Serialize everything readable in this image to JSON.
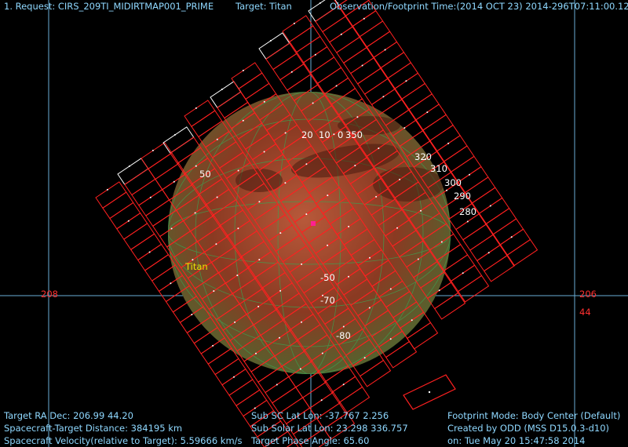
{
  "header": {
    "request": "1. Request: CIRS_209TI_MIDIRTMAP001_PRIME",
    "target": "Target: Titan",
    "observation_time": "Observation/Footprint Time:(2014 OCT 23) 2014-296T07:11:00.12"
  },
  "footer": {
    "ra_dec": "Target RA Dec: 206.99  44.20",
    "distance": "Spacecraft-Target Distance:  384195 km",
    "velocity": "Spacecraft Velocity(relative to Target): 5.59666 km/s",
    "sub_sc": "Sub SC Lat Lon: -37.767    2.256",
    "sub_solar": "Sub Solar Lat Lon: 23.298   336.757",
    "phase": "Target Phase Angle: 65.60",
    "footprint_mode": "Footprint Mode: Body Center (Default)",
    "created_by": "Created by ODD (MSS D15.0.3-d10)",
    "created_on": "on: Tue May 20 15:47:58 2014"
  },
  "axis_labels": {
    "ra_left": "208",
    "ra_right": "206",
    "dec_right": "44"
  },
  "body_label": "Titan",
  "lon_labels": [
    "0",
    "350",
    "320",
    "310",
    "300",
    "290",
    "280",
    "10",
    "20",
    "50"
  ],
  "lat_labels": [
    "-50",
    "-70",
    "-80"
  ],
  "colors": {
    "footprint": "#ff2020",
    "selected_footprint": "#ffffff",
    "grid": "#7ab8e0",
    "text": "#8fd8ff",
    "body": "#8a3a20",
    "lat_lon_grid": "#3fa050"
  }
}
